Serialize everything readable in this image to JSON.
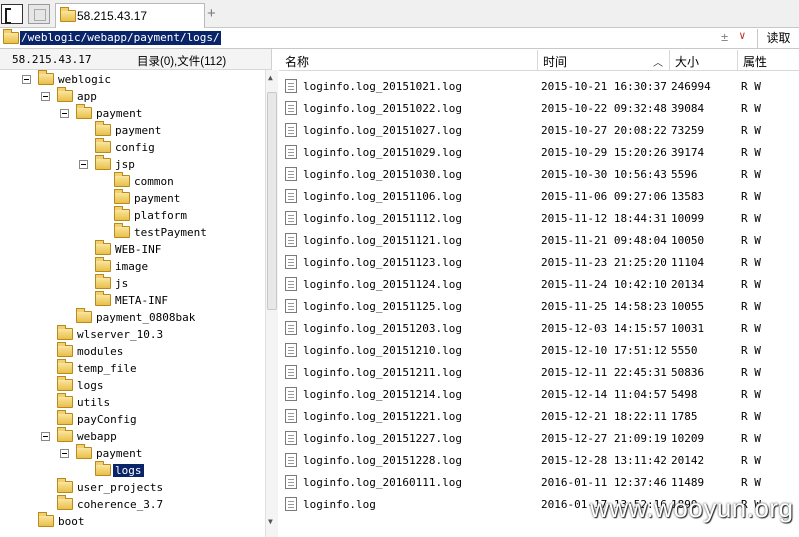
{
  "tab": {
    "title": "58.215.43.17"
  },
  "address": {
    "path": "/weblogic/webapp/payment/logs/",
    "read_label": "读取",
    "pm": "±",
    "dd": "∨"
  },
  "info": {
    "ip": "58.215.43.17",
    "counts": "目录(0),文件(112)"
  },
  "tree": [
    {
      "label": "weblogic",
      "depth": 0,
      "expanded": true
    },
    {
      "label": "app",
      "depth": 1,
      "expanded": true
    },
    {
      "label": "payment",
      "depth": 2,
      "expanded": true
    },
    {
      "label": "payment",
      "depth": 3
    },
    {
      "label": "config",
      "depth": 3
    },
    {
      "label": "jsp",
      "depth": 3,
      "expanded": true
    },
    {
      "label": "common",
      "depth": 4
    },
    {
      "label": "payment",
      "depth": 4
    },
    {
      "label": "platform",
      "depth": 4
    },
    {
      "label": "testPayment",
      "depth": 4
    },
    {
      "label": "WEB-INF",
      "depth": 3
    },
    {
      "label": "image",
      "depth": 3
    },
    {
      "label": "js",
      "depth": 3
    },
    {
      "label": "META-INF",
      "depth": 3
    },
    {
      "label": "payment_0808bak",
      "depth": 2
    },
    {
      "label": "wlserver_10.3",
      "depth": 1
    },
    {
      "label": "modules",
      "depth": 1
    },
    {
      "label": "temp_file",
      "depth": 1
    },
    {
      "label": "logs",
      "depth": 1
    },
    {
      "label": "utils",
      "depth": 1
    },
    {
      "label": "payConfig",
      "depth": 1
    },
    {
      "label": "webapp",
      "depth": 1,
      "expanded": true
    },
    {
      "label": "payment",
      "depth": 2,
      "expanded": true
    },
    {
      "label": "logs",
      "depth": 3,
      "selected": true
    },
    {
      "label": "user_projects",
      "depth": 1
    },
    {
      "label": "coherence_3.7",
      "depth": 1
    },
    {
      "label": "boot",
      "depth": 0
    }
  ],
  "columns": {
    "name": "名称",
    "time": "时间",
    "size": "大小",
    "attr": "属性",
    "sort": "︿"
  },
  "files": [
    {
      "name": "loginfo.log_20151021.log",
      "time": "2015-10-21 16:30:37",
      "size": "246994",
      "attr": "R W"
    },
    {
      "name": "loginfo.log_20151022.log",
      "time": "2015-10-22 09:32:48",
      "size": "39084",
      "attr": "R W"
    },
    {
      "name": "loginfo.log_20151027.log",
      "time": "2015-10-27 20:08:22",
      "size": "73259",
      "attr": "R W"
    },
    {
      "name": "loginfo.log_20151029.log",
      "time": "2015-10-29 15:20:26",
      "size": "39174",
      "attr": "R W"
    },
    {
      "name": "loginfo.log_20151030.log",
      "time": "2015-10-30 10:56:43",
      "size": "5596",
      "attr": "R W"
    },
    {
      "name": "loginfo.log_20151106.log",
      "time": "2015-11-06 09:27:06",
      "size": "13583",
      "attr": "R W"
    },
    {
      "name": "loginfo.log_20151112.log",
      "time": "2015-11-12 18:44:31",
      "size": "10099",
      "attr": "R W"
    },
    {
      "name": "loginfo.log_20151121.log",
      "time": "2015-11-21 09:48:04",
      "size": "10050",
      "attr": "R W"
    },
    {
      "name": "loginfo.log_20151123.log",
      "time": "2015-11-23 21:25:20",
      "size": "11104",
      "attr": "R W"
    },
    {
      "name": "loginfo.log_20151124.log",
      "time": "2015-11-24 10:42:10",
      "size": "20134",
      "attr": "R W"
    },
    {
      "name": "loginfo.log_20151125.log",
      "time": "2015-11-25 14:58:23",
      "size": "10055",
      "attr": "R W"
    },
    {
      "name": "loginfo.log_20151203.log",
      "time": "2015-12-03 14:15:57",
      "size": "10031",
      "attr": "R W"
    },
    {
      "name": "loginfo.log_20151210.log",
      "time": "2015-12-10 17:51:12",
      "size": "5550",
      "attr": "R W"
    },
    {
      "name": "loginfo.log_20151211.log",
      "time": "2015-12-11 22:45:31",
      "size": "50836",
      "attr": "R W"
    },
    {
      "name": "loginfo.log_20151214.log",
      "time": "2015-12-14 11:04:57",
      "size": "5498",
      "attr": "R W"
    },
    {
      "name": "loginfo.log_20151221.log",
      "time": "2015-12-21 18:22:11",
      "size": "1785",
      "attr": "R W"
    },
    {
      "name": "loginfo.log_20151227.log",
      "time": "2015-12-27 21:09:19",
      "size": "10209",
      "attr": "R W"
    },
    {
      "name": "loginfo.log_20151228.log",
      "time": "2015-12-28 13:11:42",
      "size": "20142",
      "attr": "R W"
    },
    {
      "name": "loginfo.log_20160111.log",
      "time": "2016-01-11 12:37:46",
      "size": "11489",
      "attr": "R W"
    },
    {
      "name": "loginfo.log",
      "time": "2016-01-17 13:52:16",
      "size": "1899",
      "attr": "R W"
    }
  ],
  "watermark": "www.wooyun.org"
}
